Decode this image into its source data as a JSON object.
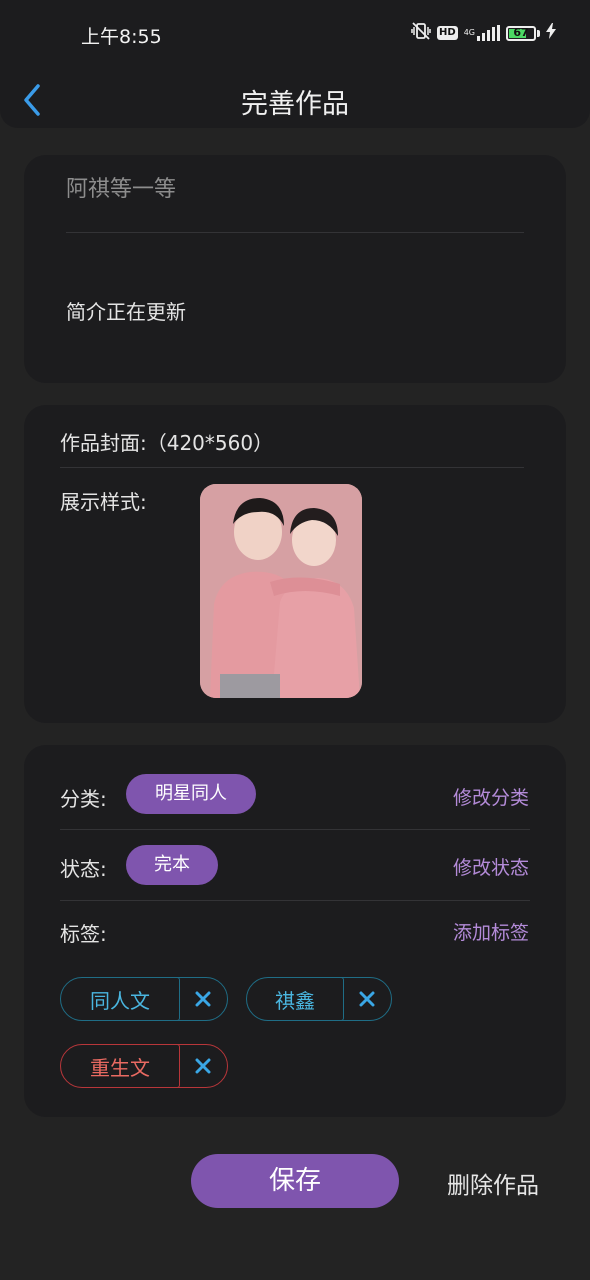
{
  "status_bar": {
    "time": "上午8:55",
    "hd": "HD",
    "network": "4G",
    "battery": "67"
  },
  "header": {
    "back_icon": "chevron-left-icon",
    "title": "完善作品"
  },
  "work": {
    "title": "阿祺等一等",
    "intro": "简介正在更新"
  },
  "cover": {
    "label": "作品封面:（420*560）",
    "display_label": "展示样式:"
  },
  "meta": {
    "category_label": "分类:",
    "category_value": "明星同人",
    "category_action": "修改分类",
    "status_label": "状态:",
    "status_value": "完本",
    "status_action": "修改状态",
    "tags_label": "标签:",
    "tags_action": "添加标签"
  },
  "tags": [
    {
      "text": "同人文",
      "color": "#1f6d86",
      "text_color": "#4ab6e0"
    },
    {
      "text": "祺鑫",
      "color": "#1f6d86",
      "text_color": "#4ab6e0"
    },
    {
      "text": "重生文",
      "color": "#b8363a",
      "text_color": "#ea6a62"
    }
  ],
  "tag_remove_icon": "close-icon",
  "tag_remove_color": "#3aa7e6",
  "actions": {
    "save": "保存",
    "delete": "删除作品"
  },
  "colors": {
    "accent": "#7f55ae",
    "link": "#b48bd9",
    "back": "#3a9be8"
  }
}
